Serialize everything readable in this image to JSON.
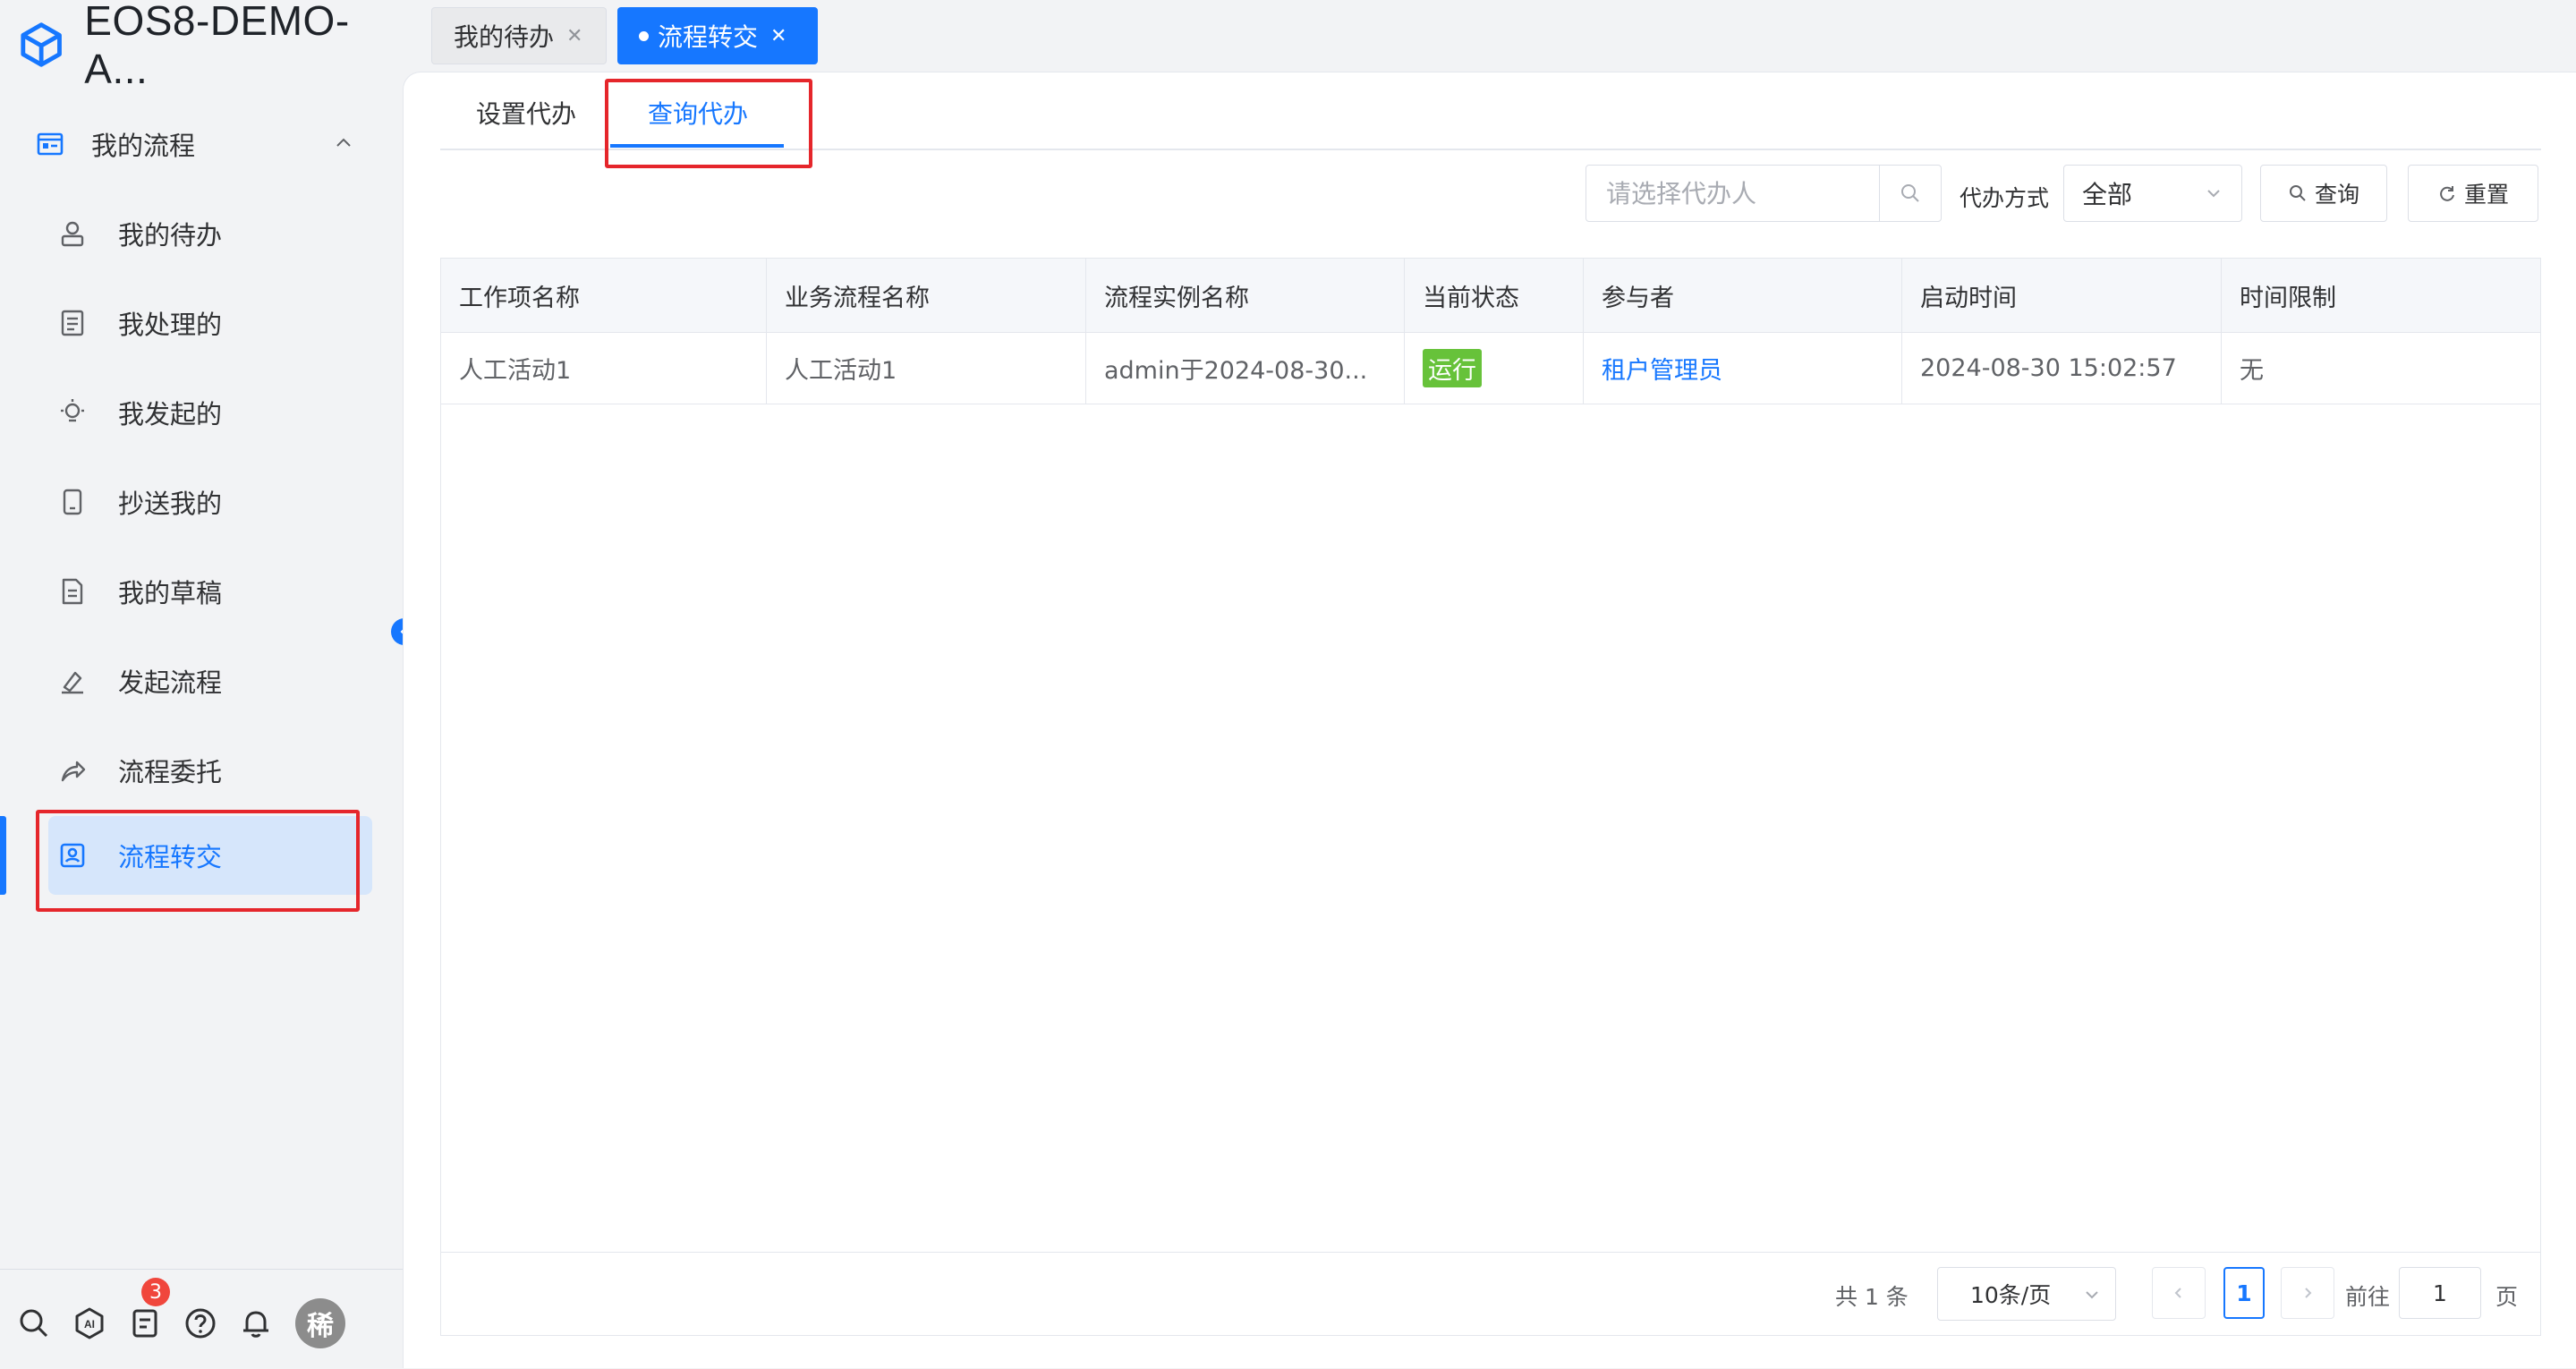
{
  "app": {
    "title": "EOS8-DEMO-A...",
    "logo_icon": "cube-logo-icon",
    "accent": "#1677ff"
  },
  "sidebar": {
    "group": {
      "label": "我的流程",
      "icon": "process-list-icon",
      "expanded": true
    },
    "items": [
      {
        "label": "我的待办",
        "icon": "user-icon"
      },
      {
        "label": "我处理的",
        "icon": "document-icon"
      },
      {
        "label": "我发起的",
        "icon": "lightbulb-icon"
      },
      {
        "label": "抄送我的",
        "icon": "tablet-icon"
      },
      {
        "label": "我的草稿",
        "icon": "draft-icon"
      },
      {
        "label": "发起流程",
        "icon": "start-process-icon"
      },
      {
        "label": "流程委托",
        "icon": "share-arrow-icon"
      },
      {
        "label": "流程转交",
        "icon": "transfer-icon",
        "active": true
      }
    ],
    "bottom": {
      "icons": [
        "search-icon",
        "ai-icon",
        "notes-icon",
        "help-icon",
        "bell-icon"
      ],
      "notes_badge": "3",
      "avatar_text": "稀"
    }
  },
  "tabs": [
    {
      "label": "我的待办",
      "active": false
    },
    {
      "label": "流程转交",
      "active": true
    }
  ],
  "subtabs": [
    {
      "label": "设置代办",
      "active": false
    },
    {
      "label": "查询代办",
      "active": true
    }
  ],
  "filters": {
    "search_placeholder": "请选择代办人",
    "mode_label": "代办方式",
    "mode_value": "全部",
    "query_label": "查询",
    "reset_label": "重置"
  },
  "table": {
    "columns": [
      "工作项名称",
      "业务流程名称",
      "流程实例名称",
      "当前状态",
      "参与者",
      "启动时间",
      "时间限制"
    ],
    "rows": [
      {
        "work_item": "人工活动1",
        "business_process": "人工活动1",
        "instance": "admin于2024-08-30...",
        "status": "运行",
        "participant": "租户管理员",
        "start_time": "2024-08-30 15:02:57",
        "time_limit": "无"
      }
    ]
  },
  "pagination": {
    "total": "共 1 条",
    "page_size": "10条/页",
    "current_page": "1",
    "goto_label": "前往",
    "goto_value": "1",
    "page_suffix": "页"
  }
}
